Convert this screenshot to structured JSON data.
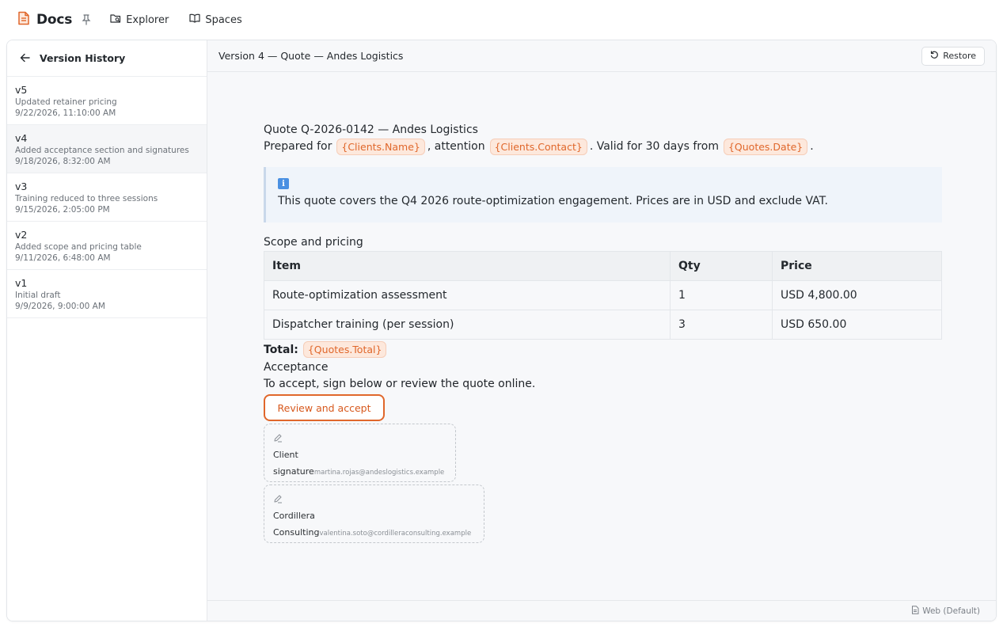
{
  "app": {
    "title": "Docs",
    "brand_color": "#e0672b",
    "nav": [
      {
        "label": "Explorer",
        "icon": "folder-search-icon"
      },
      {
        "label": "Spaces",
        "icon": "book-open-icon"
      }
    ]
  },
  "sidebar": {
    "title": "Version History",
    "versions": [
      {
        "name": "v5",
        "description": "Updated retainer pricing",
        "date": "9/22/2026, 11:10:00 AM"
      },
      {
        "name": "v4",
        "description": "Added acceptance section and signatures",
        "date": "9/18/2026, 8:32:00 AM",
        "selected": true
      },
      {
        "name": "v3",
        "description": "Training reduced to three sessions",
        "date": "9/15/2026, 2:05:00 PM"
      },
      {
        "name": "v2",
        "description": "Added scope and pricing table",
        "date": "9/11/2026, 6:48:00 AM"
      },
      {
        "name": "v1",
        "description": "Initial draft",
        "date": "9/9/2026, 9:00:00 AM"
      }
    ]
  },
  "main": {
    "title": "Version 4 — Quote — Andes Logistics",
    "restore_label": "Restore",
    "footer_label": "Web (Default)"
  },
  "document": {
    "heading": "Quote Q-2026-0142 — Andes Logistics",
    "prepared_prefix": "Prepared for",
    "chip_client_name": "{Clients.Name}",
    "attention_text": ", attention",
    "chip_client_contact": "{Clients.Contact}",
    "valid_text": ". Valid for 30 days from",
    "chip_quote_date": "{Quotes.Date}",
    "period": ".",
    "callout_icon": "info-icon",
    "callout_text": "This quote covers the Q4 2026 route-optimization engagement. Prices are in USD and exclude VAT.",
    "scope_label": "Scope and pricing",
    "table": {
      "headers": [
        "Item",
        "Qty",
        "Price"
      ],
      "rows": [
        [
          "Route-optimization assessment",
          "1",
          "USD 4,800.00"
        ],
        [
          "Dispatcher training (per session)",
          "3",
          "USD 650.00"
        ]
      ]
    },
    "total_label": "Total:",
    "chip_quote_total": "{Quotes.Total}",
    "acceptance_heading": "Acceptance",
    "acceptance_text": "To accept, sign below or review the quote online.",
    "review_button": "Review and accept",
    "signatures": [
      {
        "line1": "Client",
        "line2": "signature",
        "email": "martina.rojas@andeslogistics.example"
      },
      {
        "line1": "Cordillera",
        "line2": "Consulting",
        "email": "valentina.soto@cordilleraconsulting.example"
      }
    ]
  }
}
